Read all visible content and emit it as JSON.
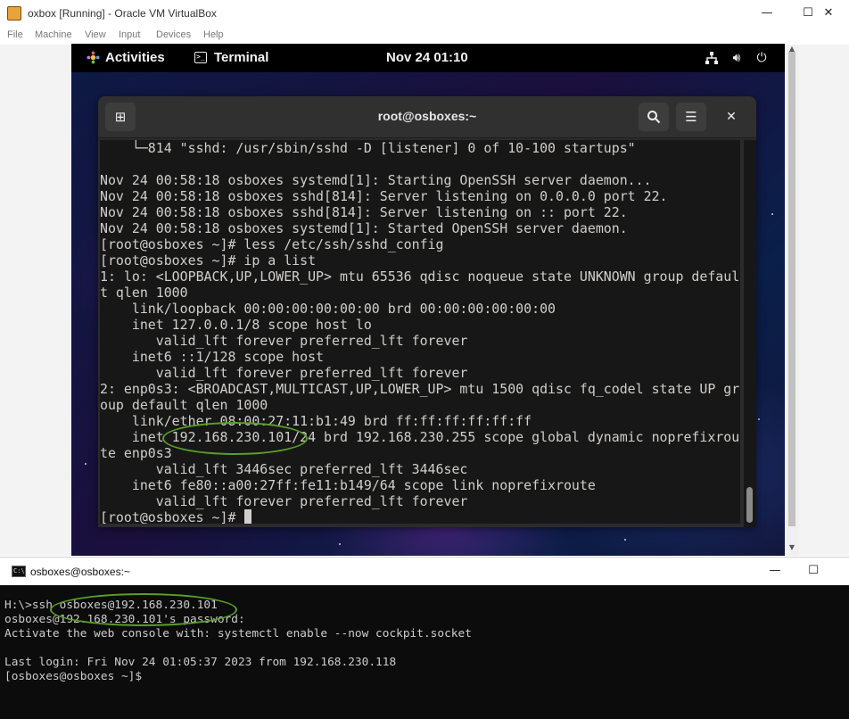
{
  "vbox": {
    "title": "oxbox [Running] - Oracle VM VirtualBox",
    "minimize_glyph": "—",
    "maximize_glyph": "☐",
    "close_glyph": "✕",
    "app_icon": "virtualbox-icon",
    "menu": [
      "File",
      "Machine",
      "View",
      "Input",
      "Devices",
      "Help"
    ]
  },
  "gnome": {
    "activities": "Activities",
    "app_name": "Terminal",
    "clock": "Nov 24  01:10",
    "tray_icons": [
      "network-icon",
      "volume-icon",
      "power-icon"
    ]
  },
  "terminal": {
    "title": "root@osboxes:~",
    "icons": [
      "new-tab-icon",
      "search-icon",
      "menu-icon",
      "close-icon"
    ],
    "lines": [
      "    └─814 \"sshd: /usr/sbin/sshd -D [listener] 0 of 10-100 startups\"",
      "",
      "Nov 24 00:58:18 osboxes systemd[1]: Starting OpenSSH server daemon...",
      "Nov 24 00:58:18 osboxes sshd[814]: Server listening on 0.0.0.0 port 22.",
      "Nov 24 00:58:18 osboxes sshd[814]: Server listening on :: port 22.",
      "Nov 24 00:58:18 osboxes systemd[1]: Started OpenSSH server daemon.",
      "[root@osboxes ~]# less /etc/ssh/sshd_config",
      "[root@osboxes ~]# ip a list",
      "1: lo: <LOOPBACK,UP,LOWER_UP> mtu 65536 qdisc noqueue state UNKNOWN group defaul",
      "t qlen 1000",
      "    link/loopback 00:00:00:00:00:00 brd 00:00:00:00:00:00",
      "    inet 127.0.0.1/8 scope host lo",
      "       valid_lft forever preferred_lft forever",
      "    inet6 ::1/128 scope host",
      "       valid_lft forever preferred_lft forever",
      "2: enp0s3: <BROADCAST,MULTICAST,UP,LOWER_UP> mtu 1500 qdisc fq_codel state UP gr",
      "oup default qlen 1000",
      "    link/ether 08:00:27:11:b1:49 brd ff:ff:ff:ff:ff:ff",
      "    inet 192.168.230.101/24 brd 192.168.230.255 scope global dynamic noprefixrou",
      "te enp0s3",
      "       valid_lft 3446sec preferred_lft 3446sec",
      "    inet6 fe80::a00:27ff:fe11:b149/64 scope link noprefixroute",
      "       valid_lft forever preferred_lft forever",
      "[root@osboxes ~]# "
    ]
  },
  "cmd": {
    "title": "osboxes@osboxes:~",
    "icon": "cmd-icon",
    "minimize_glyph": "—",
    "maximize_glyph": "☐",
    "lines": [
      "H:\\>ssh osboxes@192.168.230.101",
      "osboxes@192.168.230.101's password:",
      "Activate the web console with: systemctl enable --now cockpit.socket",
      "",
      "Last login: Fri Nov 24 01:05:37 2023 from 192.168.230.118",
      "[osboxes@osboxes ~]$"
    ]
  },
  "colors": {
    "highlight": "#5a9e2a",
    "terminal_bg": "#171717",
    "cmd_bg": "#0c0c0c"
  }
}
